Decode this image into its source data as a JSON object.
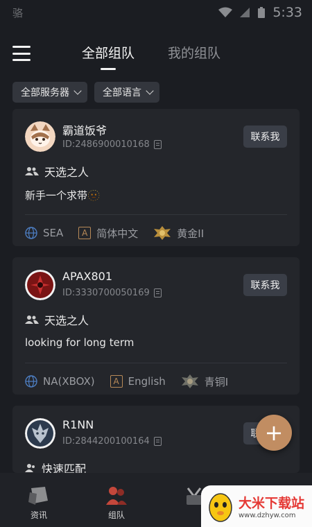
{
  "statusbar": {
    "carrier": "骆",
    "time": "5:33"
  },
  "header": {
    "tabs": [
      {
        "label": "全部组队",
        "active": true
      },
      {
        "label": "我的组队",
        "active": false
      }
    ]
  },
  "filters": [
    {
      "label": "全部服务器"
    },
    {
      "label": "全部语言"
    }
  ],
  "cards": [
    {
      "name": "霸道饭爷",
      "id": "ID:2486900010168",
      "contact": "联系我",
      "mode": "天选之人",
      "desc": "新手一个求带🫥",
      "server": "SEA",
      "language": "简体中文",
      "rank": "黄金II"
    },
    {
      "name": "APAX801",
      "id": "ID:3330700050169",
      "contact": "联系我",
      "mode": "天选之人",
      "desc": "looking for long term",
      "server": "NA(XBOX)",
      "language": "English",
      "rank": "青铜I"
    },
    {
      "name": "R1NN",
      "id": "ID:2844200100164",
      "contact": "联系我",
      "mode": "快速匹配"
    }
  ],
  "bottom_nav": [
    {
      "label": "资讯"
    },
    {
      "label": "组队"
    },
    {
      "label": ""
    },
    {
      "label": ""
    }
  ],
  "watermark": {
    "title": "大米下载站",
    "url": "www.dzhyw.com"
  },
  "colors": {
    "background": "#1b1d22",
    "card": "#24262b",
    "accent": "#c18d62",
    "button": "#3a3e47"
  }
}
